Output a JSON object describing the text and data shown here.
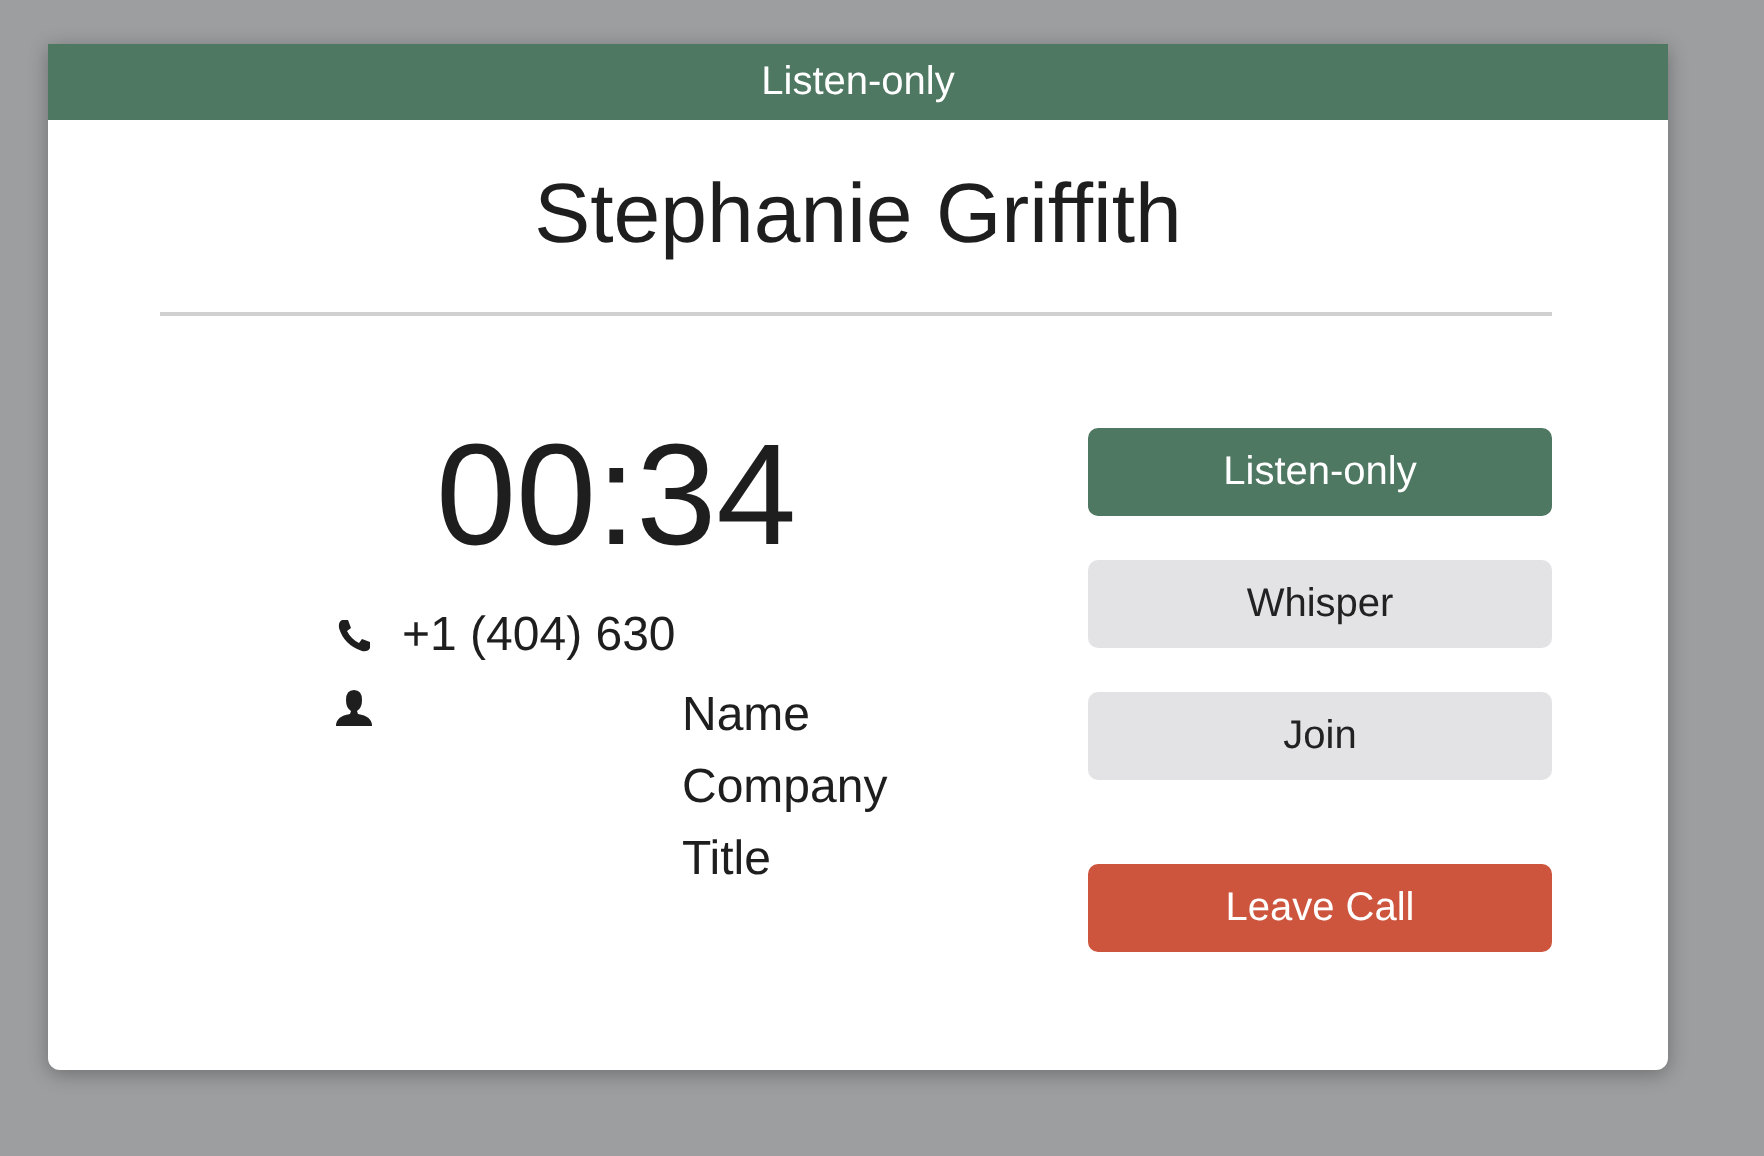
{
  "header": {
    "title": "Listen-only"
  },
  "contact_name": "Stephanie Griffith",
  "timer": "00:34",
  "phone": "+1 (404) 630",
  "person_fields": [
    "Name",
    "Company",
    "Title"
  ],
  "modes": [
    {
      "label": "Listen-only",
      "selected": true
    },
    {
      "label": "Whisper",
      "selected": false
    },
    {
      "label": "Join",
      "selected": false
    }
  ],
  "leave_button": {
    "label": "Leave Call"
  }
}
